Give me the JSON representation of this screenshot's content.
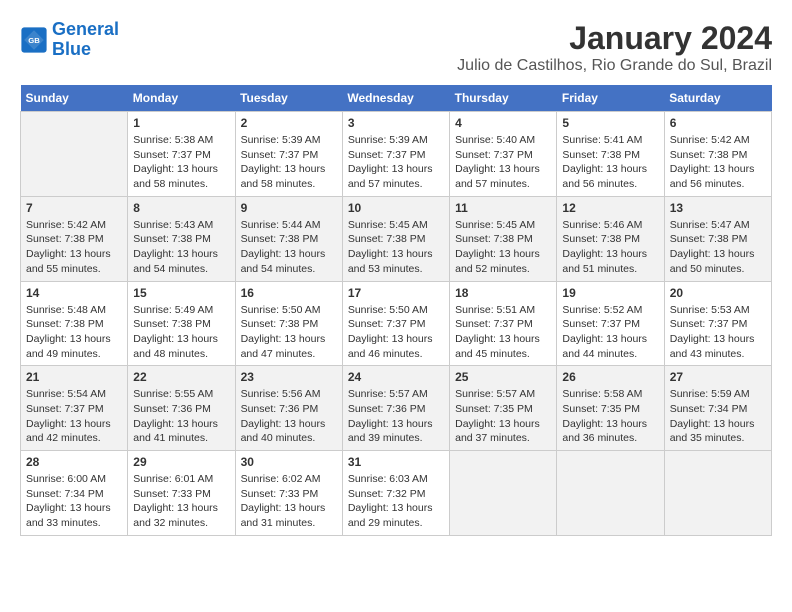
{
  "header": {
    "logo_line1": "General",
    "logo_line2": "Blue",
    "month": "January 2024",
    "location": "Julio de Castilhos, Rio Grande do Sul, Brazil"
  },
  "weekdays": [
    "Sunday",
    "Monday",
    "Tuesday",
    "Wednesday",
    "Thursday",
    "Friday",
    "Saturday"
  ],
  "weeks": [
    [
      {
        "day": null
      },
      {
        "day": 1,
        "sunrise": "5:38 AM",
        "sunset": "7:37 PM",
        "daylight": "13 hours and 58 minutes."
      },
      {
        "day": 2,
        "sunrise": "5:39 AM",
        "sunset": "7:37 PM",
        "daylight": "13 hours and 58 minutes."
      },
      {
        "day": 3,
        "sunrise": "5:39 AM",
        "sunset": "7:37 PM",
        "daylight": "13 hours and 57 minutes."
      },
      {
        "day": 4,
        "sunrise": "5:40 AM",
        "sunset": "7:37 PM",
        "daylight": "13 hours and 57 minutes."
      },
      {
        "day": 5,
        "sunrise": "5:41 AM",
        "sunset": "7:38 PM",
        "daylight": "13 hours and 56 minutes."
      },
      {
        "day": 6,
        "sunrise": "5:42 AM",
        "sunset": "7:38 PM",
        "daylight": "13 hours and 56 minutes."
      }
    ],
    [
      {
        "day": 7,
        "sunrise": "5:42 AM",
        "sunset": "7:38 PM",
        "daylight": "13 hours and 55 minutes."
      },
      {
        "day": 8,
        "sunrise": "5:43 AM",
        "sunset": "7:38 PM",
        "daylight": "13 hours and 54 minutes."
      },
      {
        "day": 9,
        "sunrise": "5:44 AM",
        "sunset": "7:38 PM",
        "daylight": "13 hours and 54 minutes."
      },
      {
        "day": 10,
        "sunrise": "5:45 AM",
        "sunset": "7:38 PM",
        "daylight": "13 hours and 53 minutes."
      },
      {
        "day": 11,
        "sunrise": "5:45 AM",
        "sunset": "7:38 PM",
        "daylight": "13 hours and 52 minutes."
      },
      {
        "day": 12,
        "sunrise": "5:46 AM",
        "sunset": "7:38 PM",
        "daylight": "13 hours and 51 minutes."
      },
      {
        "day": 13,
        "sunrise": "5:47 AM",
        "sunset": "7:38 PM",
        "daylight": "13 hours and 50 minutes."
      }
    ],
    [
      {
        "day": 14,
        "sunrise": "5:48 AM",
        "sunset": "7:38 PM",
        "daylight": "13 hours and 49 minutes."
      },
      {
        "day": 15,
        "sunrise": "5:49 AM",
        "sunset": "7:38 PM",
        "daylight": "13 hours and 48 minutes."
      },
      {
        "day": 16,
        "sunrise": "5:50 AM",
        "sunset": "7:38 PM",
        "daylight": "13 hours and 47 minutes."
      },
      {
        "day": 17,
        "sunrise": "5:50 AM",
        "sunset": "7:37 PM",
        "daylight": "13 hours and 46 minutes."
      },
      {
        "day": 18,
        "sunrise": "5:51 AM",
        "sunset": "7:37 PM",
        "daylight": "13 hours and 45 minutes."
      },
      {
        "day": 19,
        "sunrise": "5:52 AM",
        "sunset": "7:37 PM",
        "daylight": "13 hours and 44 minutes."
      },
      {
        "day": 20,
        "sunrise": "5:53 AM",
        "sunset": "7:37 PM",
        "daylight": "13 hours and 43 minutes."
      }
    ],
    [
      {
        "day": 21,
        "sunrise": "5:54 AM",
        "sunset": "7:37 PM",
        "daylight": "13 hours and 42 minutes."
      },
      {
        "day": 22,
        "sunrise": "5:55 AM",
        "sunset": "7:36 PM",
        "daylight": "13 hours and 41 minutes."
      },
      {
        "day": 23,
        "sunrise": "5:56 AM",
        "sunset": "7:36 PM",
        "daylight": "13 hours and 40 minutes."
      },
      {
        "day": 24,
        "sunrise": "5:57 AM",
        "sunset": "7:36 PM",
        "daylight": "13 hours and 39 minutes."
      },
      {
        "day": 25,
        "sunrise": "5:57 AM",
        "sunset": "7:35 PM",
        "daylight": "13 hours and 37 minutes."
      },
      {
        "day": 26,
        "sunrise": "5:58 AM",
        "sunset": "7:35 PM",
        "daylight": "13 hours and 36 minutes."
      },
      {
        "day": 27,
        "sunrise": "5:59 AM",
        "sunset": "7:34 PM",
        "daylight": "13 hours and 35 minutes."
      }
    ],
    [
      {
        "day": 28,
        "sunrise": "6:00 AM",
        "sunset": "7:34 PM",
        "daylight": "13 hours and 33 minutes."
      },
      {
        "day": 29,
        "sunrise": "6:01 AM",
        "sunset": "7:33 PM",
        "daylight": "13 hours and 32 minutes."
      },
      {
        "day": 30,
        "sunrise": "6:02 AM",
        "sunset": "7:33 PM",
        "daylight": "13 hours and 31 minutes."
      },
      {
        "day": 31,
        "sunrise": "6:03 AM",
        "sunset": "7:32 PM",
        "daylight": "13 hours and 29 minutes."
      },
      {
        "day": null
      },
      {
        "day": null
      },
      {
        "day": null
      }
    ]
  ]
}
